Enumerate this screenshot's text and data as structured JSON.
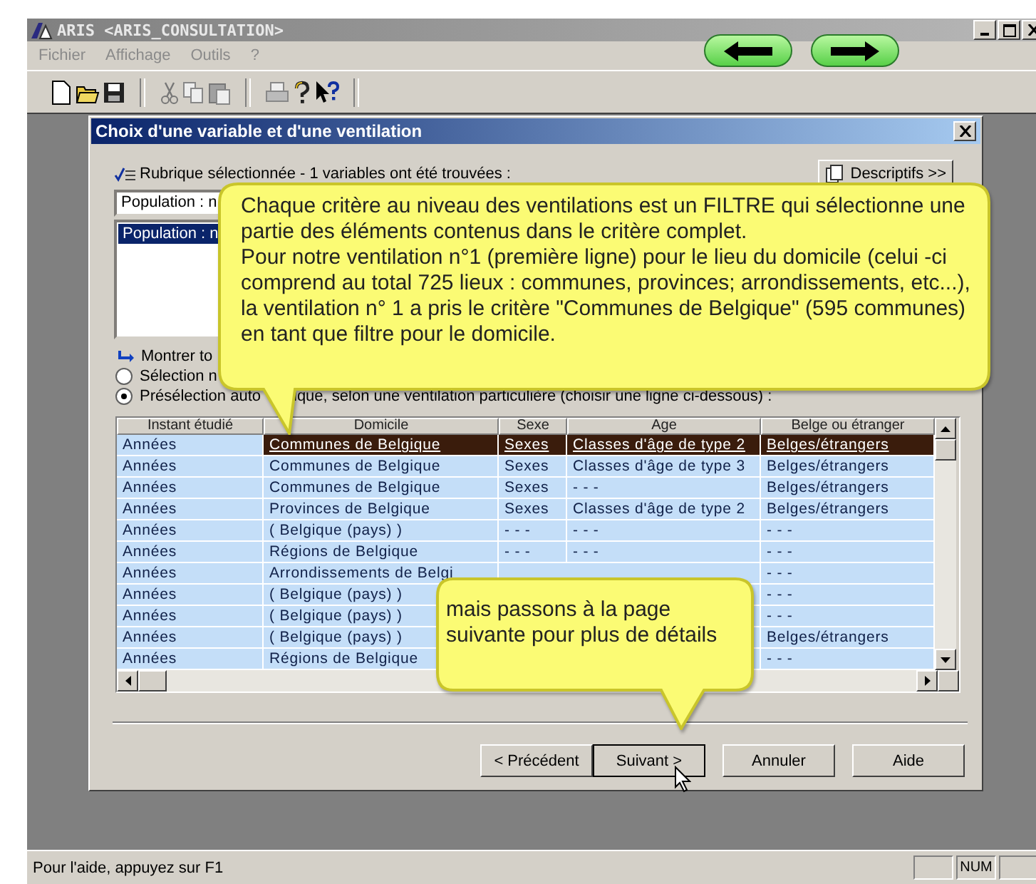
{
  "window": {
    "title": "ARIS <ARIS_CONSULTATION>"
  },
  "menu": [
    {
      "label": "Fichier",
      "disabled": true
    },
    {
      "label": "Affichage",
      "disabled": true
    },
    {
      "label": "Outils",
      "disabled": true
    },
    {
      "label": "?",
      "disabled": true
    }
  ],
  "dialog": {
    "title": "Choix d'une variable et d'une ventilation",
    "heading": "Rubrique sélectionnée - 1 variables ont été trouvées :",
    "descriptifs_button": "Descriptifs >>",
    "variable_field": {
      "value": "Population : n"
    },
    "variable_list": [
      {
        "label": "Population : n",
        "selected": true
      }
    ],
    "show_all_link": "Montrer to",
    "options": [
      {
        "parts": [
          "Sélection n"
        ],
        "selected": false
      },
      {
        "parts": [
          "Présélection auto",
          "ique, selon une ventilation particulière (choisir une ligne ci-dessous) :"
        ],
        "selected": true
      }
    ],
    "table": {
      "columns": [
        "Instant étudié",
        "Domicile",
        "Sexe",
        "Age",
        "Belge ou étranger"
      ],
      "rows": [
        {
          "cells": [
            "Années",
            "Communes de Belgique",
            "Sexes",
            "Classes d'âge de type 2",
            "Belges/étrangers"
          ],
          "selected": true
        },
        {
          "cells": [
            "Années",
            "Communes de Belgique",
            "Sexes",
            "Classes d'âge de type 3",
            "Belges/étrangers"
          ],
          "selected": false
        },
        {
          "cells": [
            "Années",
            "Communes de Belgique",
            "Sexes",
            "- - -",
            "Belges/étrangers"
          ],
          "selected": false
        },
        {
          "cells": [
            "Années",
            "Provinces de Belgique",
            "Sexes",
            "Classes d'âge de type 2",
            "Belges/étrangers"
          ],
          "selected": false
        },
        {
          "cells": [
            "Années",
            "( Belgique (pays) )",
            "- - -",
            "- - -",
            "- - -"
          ],
          "selected": false
        },
        {
          "cells": [
            "Années",
            "Régions de Belgique",
            "- - -",
            "- - -",
            "- - -"
          ],
          "selected": false
        },
        {
          "cells": [
            "Années",
            "Arrondissements de Belgi",
            null,
            null,
            "- - -"
          ],
          "selected": false
        },
        {
          "cells": [
            "Années",
            "( Belgique (pays) )",
            null,
            null,
            "- - -"
          ],
          "selected": false
        },
        {
          "cells": [
            "Années",
            "( Belgique (pays) )",
            null,
            null,
            "- - -"
          ],
          "selected": false
        },
        {
          "cells": [
            "Années",
            "( Belgique (pays) )",
            null,
            null,
            "Belges/étrangers"
          ],
          "selected": false
        },
        {
          "cells": [
            "Années",
            "Régions de Belgique",
            null,
            null,
            "- - -"
          ],
          "selected": false
        }
      ]
    },
    "buttons": [
      {
        "label": "< Précédent",
        "focused": false
      },
      {
        "label": "Suivant >",
        "focused": true
      },
      {
        "label": "Annuler",
        "focused": false
      },
      {
        "label": "Aide",
        "focused": false
      }
    ]
  },
  "callouts": [
    {
      "text": "Chaque critère au niveau des ventilations est un FILTRE qui sélectionne une partie des éléments contenus dans le critère complet.\nPour notre ventilation n°1 (première ligne) pour le lieu du domicile (celui -ci comprend au total 725 lieux : communes, provinces; arrondissements, etc...), la ventilation n° 1 a pris le critère \"Communes de Belgique\" (595 communes) en tant que filtre pour le domicile."
    },
    {
      "text": "mais passons à la page suivante pour plus de détails"
    }
  ],
  "status_bar": {
    "message": "Pour l'aide, appuyez sur F1",
    "indicator": "NUM"
  }
}
